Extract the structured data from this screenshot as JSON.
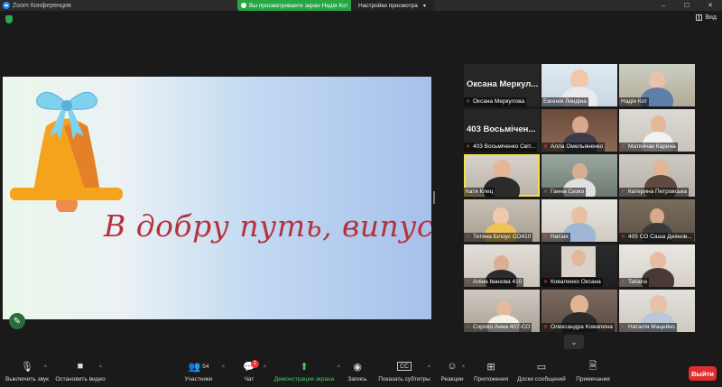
{
  "window": {
    "title": "Zoom Конференция",
    "controls": [
      "–",
      "☐",
      "✕"
    ]
  },
  "share_banner": {
    "status": "Вы просматриваете экран Надія Кот",
    "view_options": "Настройки просмотра"
  },
  "view_button": "Вид",
  "slide": {
    "text": "В добру путь, випускники!",
    "colors": {
      "text": "#b5323d",
      "bell": "#f5a21c",
      "bow": "#7fd1ee"
    }
  },
  "participants": [
    {
      "big_name": "Оксана Меркул...",
      "label": "Оксана Меркулова",
      "muted": true,
      "video": false
    },
    {
      "label": "Евгенія Линдіна",
      "muted": false,
      "video": true
    },
    {
      "label": "Надія Кот",
      "muted": false,
      "video": true
    },
    {
      "big_name": "403 Восьмічен...",
      "label": "403 Восьміченко Світ...",
      "muted": true,
      "video": false
    },
    {
      "label": "Алла Омельяненко",
      "muted": true,
      "video": true
    },
    {
      "label": "Матийчак Карина",
      "muted": true,
      "video": true
    },
    {
      "label": "Катя Клец",
      "muted": false,
      "video": true,
      "active": true
    },
    {
      "label": "Ганна Сизко",
      "muted": true,
      "video": true
    },
    {
      "label": "Катерина Петровська",
      "muted": true,
      "video": true
    },
    {
      "label": "Тетяна Білоус СО410",
      "muted": true,
      "video": true
    },
    {
      "label": "Натаія",
      "muted": true,
      "video": true
    },
    {
      "label": "405 СО Саша Деянов...",
      "muted": true,
      "video": true
    },
    {
      "label": "Аліна Іванова 410",
      "muted": true,
      "video": true
    },
    {
      "label": "Коваленко Оксана",
      "muted": true,
      "video": true
    },
    {
      "label": "Tatiana",
      "muted": true,
      "video": true
    },
    {
      "label": "Сороко Анна 407-СО",
      "muted": true,
      "video": true
    },
    {
      "label": "Олександра Кожапкіна",
      "muted": true,
      "video": true
    },
    {
      "label": "Наталія Мацейко",
      "muted": true,
      "video": true
    }
  ],
  "toolbar": {
    "mute": "Выключить звук",
    "video": "Остановить видео",
    "participants": "Участники",
    "participants_count": "54",
    "chat": "Чат",
    "chat_badge": "1",
    "share": "Демонстрация экрана",
    "record": "Запись",
    "subtitles": "Показать субтитры",
    "subtitles_icon": "CC",
    "reactions": "Реакции",
    "apps": "Приложения",
    "whiteboard": "Доски сообщений",
    "notes": "Примечания",
    "end": "Выйти"
  }
}
